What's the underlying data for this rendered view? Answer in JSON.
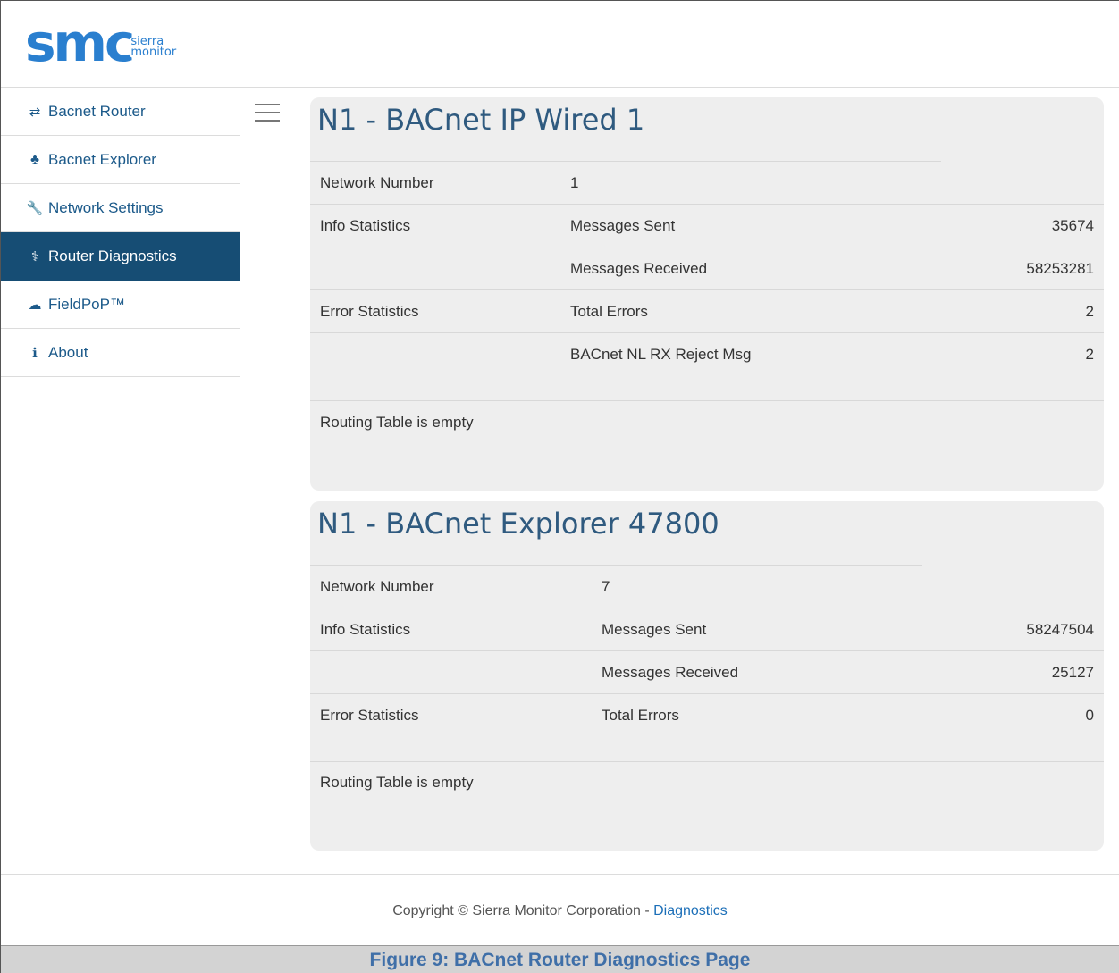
{
  "logo": {
    "mark": "smc",
    "sub_line1": "sierra",
    "sub_line2": "monitor"
  },
  "sidebar": {
    "items": [
      {
        "icon": "exchange-icon",
        "glyph": "⇄",
        "label": "Bacnet Router"
      },
      {
        "icon": "sitemap-icon",
        "glyph": "♣",
        "label": "Bacnet Explorer"
      },
      {
        "icon": "wrench-icon",
        "glyph": "🔧",
        "label": "Network Settings"
      },
      {
        "icon": "stethoscope-icon",
        "glyph": "⚕",
        "label": "Router Diagnostics",
        "active": true
      },
      {
        "icon": "cloud-icon",
        "glyph": "☁",
        "label": "FieldPoP™"
      },
      {
        "icon": "info-circle-icon",
        "glyph": "ℹ",
        "label": "About"
      }
    ]
  },
  "panels": [
    {
      "title": "N1 - BACnet IP Wired 1",
      "rows": [
        {
          "c1": "Network Number",
          "c2": "1",
          "c3": ""
        },
        {
          "c1": "Info Statistics",
          "c2": "Messages Sent",
          "c3": "35674"
        },
        {
          "c1": "",
          "c2": "Messages Received",
          "c3": "58253281"
        },
        {
          "c1": "Error Statistics",
          "c2": "Total Errors",
          "c3": "2"
        },
        {
          "c1": "",
          "c2": "BACnet NL RX Reject Msg",
          "c3": "2"
        }
      ],
      "routing_note": "Routing Table is empty"
    },
    {
      "title": "N1 - BACnet Explorer 47800",
      "rows": [
        {
          "c1": "Network Number",
          "c2": "7",
          "c3": ""
        },
        {
          "c1": "Info Statistics",
          "c2": "Messages Sent",
          "c3": "58247504"
        },
        {
          "c1": "",
          "c2": "Messages Received",
          "c3": "25127"
        },
        {
          "c1": "Error Statistics",
          "c2": "Total Errors",
          "c3": "0"
        }
      ],
      "routing_note": "Routing Table is empty"
    }
  ],
  "footer": {
    "copyright": "Copyright © Sierra Monitor Corporation - ",
    "link": "Diagnostics"
  },
  "caption": "Figure 9: BACnet Router Diagnostics Page",
  "colors": {
    "accent": "#164d74",
    "link": "#1c5a8a",
    "title": "#2f5a7f",
    "caption": "#3f6fa8"
  }
}
